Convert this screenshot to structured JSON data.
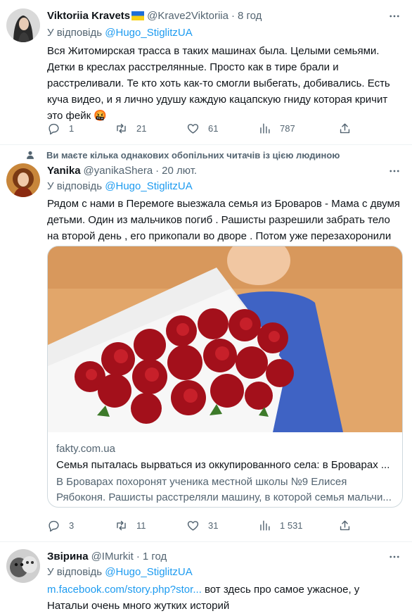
{
  "tweets": [
    {
      "name": "Viktoriia Kravets",
      "handle": "@Krave2Viktoriia",
      "time": "8 год",
      "reply_to_prefix": "У відповідь",
      "reply_to_handle": "@Hugo_StiglitzUA",
      "text": "Вся Житомирская трасса в таких машинах была. Целыми семьями. Детки в креслах расстрелянные. Просто как в тире брали и расстреливали. Те кто хоть как-то смогли выбегать, добивались. Есть куча видео, и я лично удушу каждую кацапскую гниду которая кричит это фейк 🤬",
      "stats": {
        "replies": "1",
        "retweets": "21",
        "likes": "61",
        "views": "787"
      }
    },
    {
      "social_context": "Ви маєте кілька однакових обопільних читачів із цією людиною",
      "name": "Yanika",
      "handle": "@yanikaShera",
      "time": "20 лют.",
      "reply_to_prefix": "У відповідь",
      "reply_to_handle": "@Hugo_StiglitzUA",
      "text": "Рядом с нами в Перемоге выезжала семья из Броваров - Мама с двумя детьми. Один из мальчиков погиб . Рашисты разрешили забрать тело на второй день , его прикопали во дворе . Потом уже перезахоронили",
      "card": {
        "domain": "fakty.com.ua",
        "title": "Семья пыталась вырваться из оккупированного села: в Броварах ...",
        "description": "В Броварах похоронят ученика местной школы №9 Елисея Рябоконя. Рашисты расстреляли машину, в которой семья мальчи..."
      },
      "stats": {
        "replies": "3",
        "retweets": "11",
        "likes": "31",
        "views": "1 531"
      }
    },
    {
      "name": "Звірина",
      "handle": "@IMurkit",
      "time": "1 год",
      "reply_to_prefix": "У відповідь",
      "reply_to_handle": "@Hugo_StiglitzUA",
      "link_text": "m.facebook.com/story.php?stor...",
      "text_after_link": " вот здесь про самое ужасное, у Натальи очень много жутких историй"
    }
  ],
  "icons": {
    "reply": "reply-icon",
    "retweet": "retweet-icon",
    "like": "heart-icon",
    "views": "views-icon",
    "share": "share-icon",
    "more": "more-icon",
    "followers": "person-icon",
    "flag": "ukraine-flag-icon"
  },
  "colors": {
    "text": "#0f1419",
    "secondary": "#536471",
    "link": "#1d9bf0",
    "border": "#eff3f4",
    "card_border": "#cfd9de"
  }
}
